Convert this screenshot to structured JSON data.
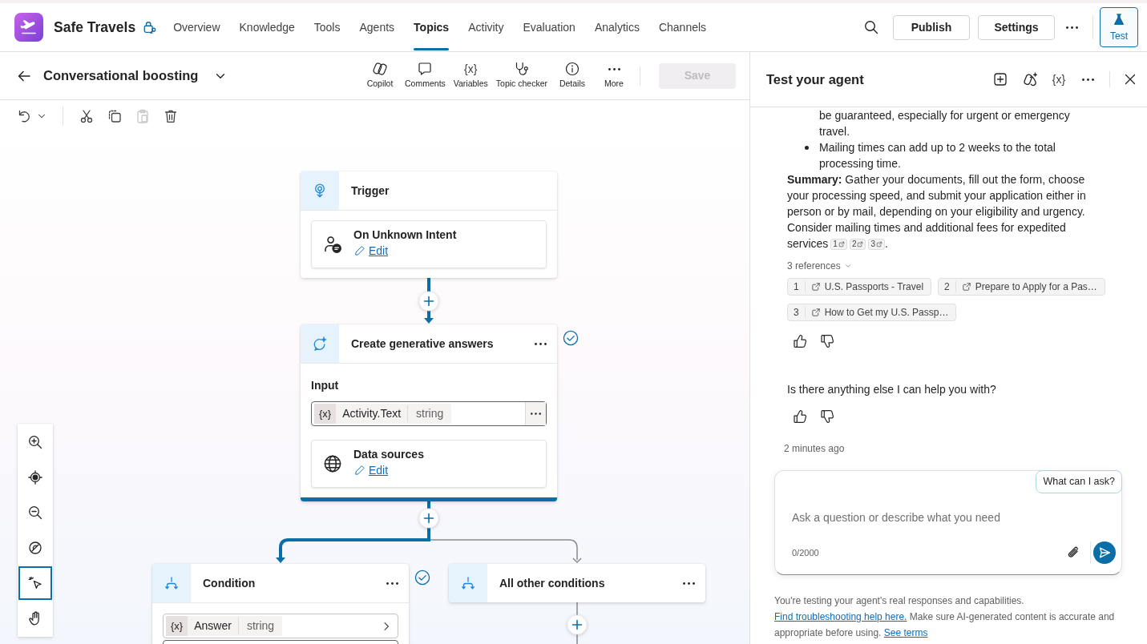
{
  "app": {
    "title": "Safe Travels"
  },
  "nav_tabs": [
    {
      "label": "Overview",
      "selected": false
    },
    {
      "label": "Knowledge",
      "selected": false
    },
    {
      "label": "Tools",
      "selected": false
    },
    {
      "label": "Agents",
      "selected": false
    },
    {
      "label": "Topics",
      "selected": true
    },
    {
      "label": "Activity",
      "selected": false
    },
    {
      "label": "Evaluation",
      "selected": false
    },
    {
      "label": "Analytics",
      "selected": false
    },
    {
      "label": "Channels",
      "selected": false
    }
  ],
  "header_buttons": [
    {
      "label": "Publish"
    },
    {
      "label": "Settings"
    }
  ],
  "test_button": {
    "label": "Test",
    "on": true
  },
  "topic": {
    "title": "Conversational boosting"
  },
  "topic_tools": [
    {
      "label": "Copilot"
    },
    {
      "label": "Comments"
    },
    {
      "label": "Variables",
      "glyph": "{x}"
    },
    {
      "label": "Topic checker"
    },
    {
      "label": "Details"
    },
    {
      "label": "More"
    }
  ],
  "save_button": {
    "label": "Save",
    "disabled": true
  },
  "edit_tools": [
    {
      "disabled": false
    },
    {
      "disabled": false
    },
    {
      "disabled": false
    },
    {
      "disabled": true
    },
    {
      "disabled": false
    }
  ],
  "flow": {
    "kind": "trigger",
    "title": "Trigger",
    "has_menu": false,
    "validated": false,
    "selected": false,
    "items": [
      {
        "kind": "event",
        "title": "On Unknown Intent",
        "link": "Edit"
      }
    ],
    "children": [
      {
        "kind": "generative",
        "title": "Create generative answers",
        "has_menu": true,
        "validated": true,
        "selected": true,
        "connector_active": true,
        "items": [
          {
            "kind": "label",
            "text": "Input"
          },
          {
            "kind": "input_variable",
            "glyph": "{x}",
            "name": "Activity.Text",
            "type": "string"
          },
          {
            "kind": "sources",
            "title": "Data sources",
            "link": "Edit"
          }
        ],
        "children": [
          {
            "kind": "condition",
            "title": "Condition",
            "has_menu": true,
            "validated": true,
            "selected": false,
            "connector_active": true,
            "items": [
              {
                "kind": "condition_variable",
                "glyph": "{x}",
                "name": "Answer",
                "type": "string"
              },
              {
                "kind": "blank_field"
              }
            ]
          },
          {
            "kind": "condition",
            "title": "All other conditions",
            "has_menu": true,
            "validated": false,
            "selected": false,
            "connector_active": false
          }
        ]
      }
    ]
  },
  "canvas_tools": [
    {
      "selected": false
    },
    {
      "selected": false
    },
    {
      "selected": false
    },
    {
      "selected": false
    },
    {
      "selected": true
    },
    {
      "selected": false
    }
  ],
  "test_panel": {
    "title": "Test your agent",
    "variables_glyph": "{x}",
    "messages": [
      {
        "kind": "answer",
        "bullets": [
          {
            "kind": "continuation",
            "text": "be guaranteed, especially for urgent or emergency travel."
          },
          {
            "kind": "bullet",
            "text": "Mailing times can add up to 2 weeks to the total processing time."
          }
        ],
        "summary": "**Summary:** Gather your documents, fill out the form, choose your processing speed, and submit your application either in person or by mail, depending on your eligibility and urgency. Consider mailing times and additional fees for expedited services",
        "citations": [
          "1",
          "2",
          "3"
        ],
        "summary_end": ".",
        "references_label": "3 references",
        "references_expanded": true,
        "references": [
          {
            "number": "1",
            "title": "U.S. Passports - Travel"
          },
          {
            "number": "2",
            "title": "Prepare to Apply for a Pas…"
          },
          {
            "number": "3",
            "title": "How to Get my U.S. Passp…"
          }
        ]
      },
      {
        "kind": "text",
        "text": "Is there anything else I can help you with?"
      }
    ],
    "timestamp": "2 minutes ago",
    "suggestion": "What can I ask?",
    "placeholder": "Ask a question or describe what you need",
    "counter": "0/2000",
    "disclaimer": [
      {
        "kind": "text",
        "text": "You're testing your agent's real responses and capabilities."
      },
      {
        "kind": "link",
        "text": "Find troubleshooting help here."
      },
      {
        "kind": "text",
        "text": "Make sure AI-generated content is accurate and appropriate before using."
      },
      {
        "kind": "link",
        "text": "See terms"
      }
    ]
  }
}
